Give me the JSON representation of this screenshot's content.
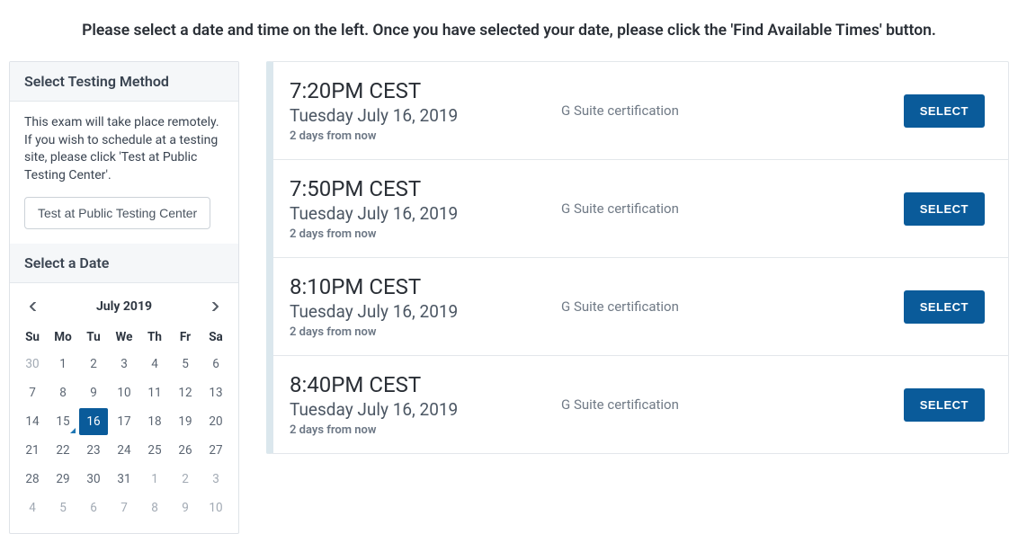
{
  "instruction": "Please select a date and time on the left. Once you have selected your date, please click the 'Find Available Times' button.",
  "sidebar": {
    "method_title": "Select Testing Method",
    "method_desc": "This exam will take place remotely. If you wish to schedule at a testing site, please click 'Test at Public Testing Center'.",
    "test_center_btn": "Test at Public Testing Center",
    "date_title": "Select a Date"
  },
  "calendar": {
    "month_label": "July 2019",
    "dow": [
      "Su",
      "Mo",
      "Tu",
      "We",
      "Th",
      "Fr",
      "Sa"
    ],
    "weeks": [
      [
        {
          "d": "30",
          "dim": true
        },
        {
          "d": "1"
        },
        {
          "d": "2"
        },
        {
          "d": "3"
        },
        {
          "d": "4"
        },
        {
          "d": "5"
        },
        {
          "d": "6"
        }
      ],
      [
        {
          "d": "7"
        },
        {
          "d": "8"
        },
        {
          "d": "9"
        },
        {
          "d": "10"
        },
        {
          "d": "11"
        },
        {
          "d": "12"
        },
        {
          "d": "13"
        }
      ],
      [
        {
          "d": "14"
        },
        {
          "d": "15",
          "marker": true
        },
        {
          "d": "16",
          "selected": true
        },
        {
          "d": "17"
        },
        {
          "d": "18"
        },
        {
          "d": "19"
        },
        {
          "d": "20"
        }
      ],
      [
        {
          "d": "21"
        },
        {
          "d": "22"
        },
        {
          "d": "23"
        },
        {
          "d": "24"
        },
        {
          "d": "25"
        },
        {
          "d": "26"
        },
        {
          "d": "27"
        }
      ],
      [
        {
          "d": "28"
        },
        {
          "d": "29"
        },
        {
          "d": "30"
        },
        {
          "d": "31"
        },
        {
          "d": "1",
          "dim": true
        },
        {
          "d": "2",
          "dim": true
        },
        {
          "d": "3",
          "dim": true
        }
      ],
      [
        {
          "d": "4",
          "dim": true
        },
        {
          "d": "5",
          "dim": true
        },
        {
          "d": "6",
          "dim": true
        },
        {
          "d": "7",
          "dim": true
        },
        {
          "d": "8",
          "dim": true
        },
        {
          "d": "9",
          "dim": true
        },
        {
          "d": "10",
          "dim": true
        }
      ]
    ]
  },
  "slots": [
    {
      "time": "7:20PM CEST",
      "date": "Tuesday July 16, 2019",
      "rel": "2 days from now",
      "exam": "G Suite certification",
      "btn": "SELECT"
    },
    {
      "time": "7:50PM CEST",
      "date": "Tuesday July 16, 2019",
      "rel": "2 days from now",
      "exam": "G Suite certification",
      "btn": "SELECT"
    },
    {
      "time": "8:10PM CEST",
      "date": "Tuesday July 16, 2019",
      "rel": "2 days from now",
      "exam": "G Suite certification",
      "btn": "SELECT"
    },
    {
      "time": "8:40PM CEST",
      "date": "Tuesday July 16, 2019",
      "rel": "2 days from now",
      "exam": "G Suite certification",
      "btn": "SELECT"
    }
  ]
}
